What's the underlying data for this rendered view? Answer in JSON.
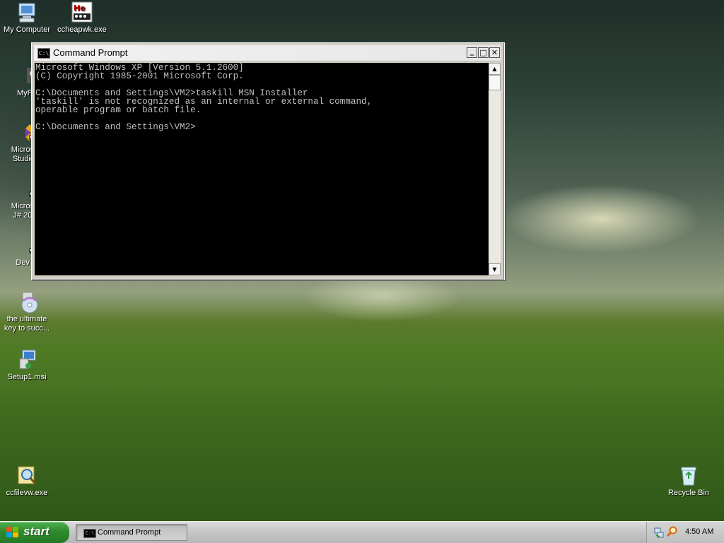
{
  "desktop": {
    "icons": [
      {
        "label": "My Computer"
      },
      {
        "label": "ccheapwk.exe"
      },
      {
        "label": "MyPa"
      },
      {
        "label": "Microsoft\nStudio 2"
      },
      {
        "label": "Microsoft\nJ# 2005"
      },
      {
        "label": "Dev-C"
      },
      {
        "label": "the ultimate\nkey to succ..."
      },
      {
        "label": "Setup1.msi"
      },
      {
        "label": "ccfilevw.exe"
      },
      {
        "label": "Recycle Bin"
      }
    ]
  },
  "window": {
    "title": "Command Prompt",
    "icon_text": "C:\\",
    "buttons": {
      "minimize": "_",
      "maximize": "□",
      "close": "✕"
    },
    "console_lines": [
      "Microsoft Windows XP [Version 5.1.2600]",
      "(C) Copyright 1985-2001 Microsoft Corp.",
      "",
      "C:\\Documents and Settings\\VM2>taskill MSN Installer",
      "'taskill' is not recognized as an internal or external command,",
      "operable program or batch file.",
      "",
      "C:\\Documents and Settings\\VM2>"
    ]
  },
  "taskbar": {
    "start_label": "start",
    "tasks": [
      {
        "label": "Command Prompt",
        "icon_text": "C:\\"
      }
    ],
    "clock": "4:50 AM"
  },
  "colors": {
    "console_bg": "#000000",
    "console_fg": "#c0c0c0",
    "start_green": "#2e8b2e"
  }
}
